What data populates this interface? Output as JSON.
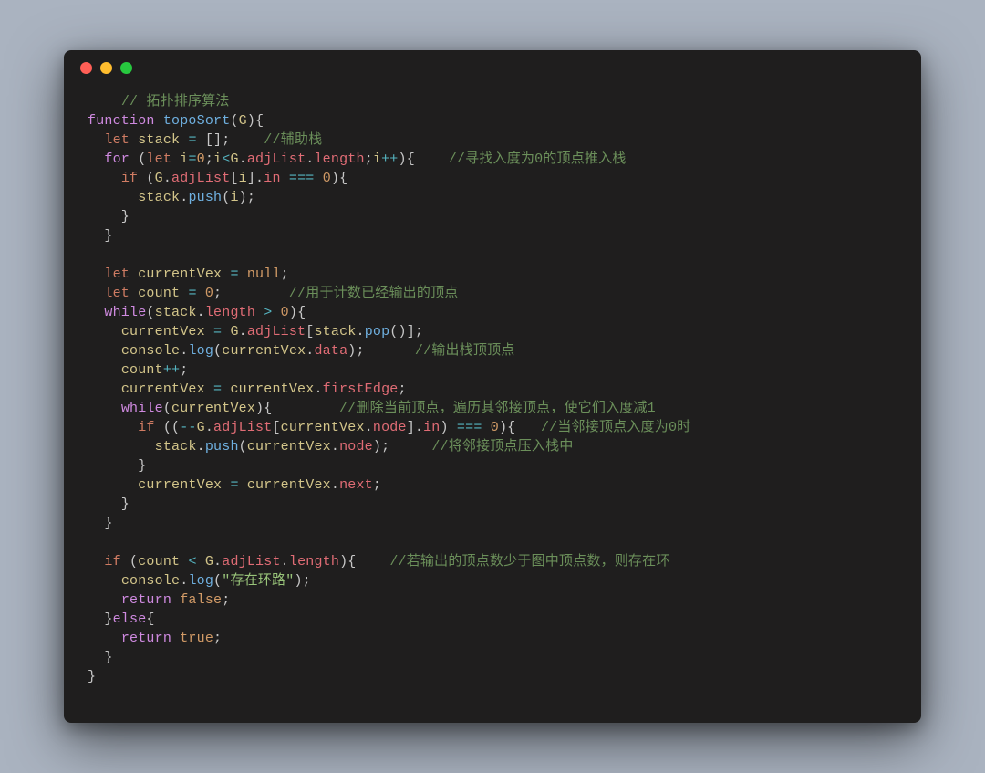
{
  "language": "javascript",
  "theme": "dark-mac-window",
  "window": {
    "traffic_lights": [
      "close",
      "minimize",
      "zoom"
    ]
  },
  "code_tokens": [
    [
      [
        "pl",
        "    "
      ],
      [
        "cmt",
        "// 拓扑排序算法"
      ]
    ],
    [
      [
        "kw",
        "function"
      ],
      [
        "pl",
        " "
      ],
      [
        "fn",
        "topoSort"
      ],
      [
        "pl",
        "("
      ],
      [
        "id",
        "G"
      ],
      [
        "pl",
        "){"
      ]
    ],
    [
      [
        "pl",
        "  "
      ],
      [
        "kw2",
        "let"
      ],
      [
        "pl",
        " "
      ],
      [
        "id",
        "stack"
      ],
      [
        "pl",
        " "
      ],
      [
        "op",
        "="
      ],
      [
        "pl",
        " [];    "
      ],
      [
        "cmt",
        "//辅助栈"
      ]
    ],
    [
      [
        "pl",
        "  "
      ],
      [
        "kw",
        "for"
      ],
      [
        "pl",
        " ("
      ],
      [
        "kw2",
        "let"
      ],
      [
        "pl",
        " "
      ],
      [
        "id",
        "i"
      ],
      [
        "op",
        "="
      ],
      [
        "num",
        "0"
      ],
      [
        "pl",
        ";"
      ],
      [
        "id",
        "i"
      ],
      [
        "op",
        "<"
      ],
      [
        "id",
        "G"
      ],
      [
        "pl",
        "."
      ],
      [
        "prop",
        "adjList"
      ],
      [
        "pl",
        "."
      ],
      [
        "prop",
        "length"
      ],
      [
        "pl",
        ";"
      ],
      [
        "id",
        "i"
      ],
      [
        "op",
        "++"
      ],
      [
        "pl",
        "){    "
      ],
      [
        "cmt",
        "//寻找入度为0的顶点推入栈"
      ]
    ],
    [
      [
        "pl",
        "    "
      ],
      [
        "kw2",
        "if"
      ],
      [
        "pl",
        " ("
      ],
      [
        "id",
        "G"
      ],
      [
        "pl",
        "."
      ],
      [
        "prop",
        "adjList"
      ],
      [
        "pl",
        "["
      ],
      [
        "id",
        "i"
      ],
      [
        "pl",
        "]."
      ],
      [
        "prop",
        "in"
      ],
      [
        "pl",
        " "
      ],
      [
        "op",
        "==="
      ],
      [
        "pl",
        " "
      ],
      [
        "num",
        "0"
      ],
      [
        "pl",
        "){"
      ]
    ],
    [
      [
        "pl",
        "      "
      ],
      [
        "id",
        "stack"
      ],
      [
        "pl",
        "."
      ],
      [
        "fn",
        "push"
      ],
      [
        "pl",
        "("
      ],
      [
        "id",
        "i"
      ],
      [
        "pl",
        ");"
      ]
    ],
    [
      [
        "pl",
        "    }"
      ]
    ],
    [
      [
        "pl",
        "  }"
      ]
    ],
    [
      [
        "pl",
        ""
      ]
    ],
    [
      [
        "pl",
        "  "
      ],
      [
        "kw2",
        "let"
      ],
      [
        "pl",
        " "
      ],
      [
        "id",
        "currentVex"
      ],
      [
        "pl",
        " "
      ],
      [
        "op",
        "="
      ],
      [
        "pl",
        " "
      ],
      [
        "num",
        "null"
      ],
      [
        "pl",
        ";"
      ]
    ],
    [
      [
        "pl",
        "  "
      ],
      [
        "kw2",
        "let"
      ],
      [
        "pl",
        " "
      ],
      [
        "id",
        "count"
      ],
      [
        "pl",
        " "
      ],
      [
        "op",
        "="
      ],
      [
        "pl",
        " "
      ],
      [
        "num",
        "0"
      ],
      [
        "pl",
        ";        "
      ],
      [
        "cmt",
        "//用于计数已经输出的顶点"
      ]
    ],
    [
      [
        "pl",
        "  "
      ],
      [
        "kw",
        "while"
      ],
      [
        "pl",
        "("
      ],
      [
        "id",
        "stack"
      ],
      [
        "pl",
        "."
      ],
      [
        "prop",
        "length"
      ],
      [
        "pl",
        " "
      ],
      [
        "op",
        ">"
      ],
      [
        "pl",
        " "
      ],
      [
        "num",
        "0"
      ],
      [
        "pl",
        "){"
      ]
    ],
    [
      [
        "pl",
        "    "
      ],
      [
        "id",
        "currentVex"
      ],
      [
        "pl",
        " "
      ],
      [
        "op",
        "="
      ],
      [
        "pl",
        " "
      ],
      [
        "id",
        "G"
      ],
      [
        "pl",
        "."
      ],
      [
        "prop",
        "adjList"
      ],
      [
        "pl",
        "["
      ],
      [
        "id",
        "stack"
      ],
      [
        "pl",
        "."
      ],
      [
        "fn",
        "pop"
      ],
      [
        "pl",
        "()];"
      ]
    ],
    [
      [
        "pl",
        "    "
      ],
      [
        "id",
        "console"
      ],
      [
        "pl",
        "."
      ],
      [
        "fn",
        "log"
      ],
      [
        "pl",
        "("
      ],
      [
        "id",
        "currentVex"
      ],
      [
        "pl",
        "."
      ],
      [
        "prop",
        "data"
      ],
      [
        "pl",
        ");      "
      ],
      [
        "cmt",
        "//输出栈顶顶点"
      ]
    ],
    [
      [
        "pl",
        "    "
      ],
      [
        "id",
        "count"
      ],
      [
        "op",
        "++"
      ],
      [
        "pl",
        ";"
      ]
    ],
    [
      [
        "pl",
        "    "
      ],
      [
        "id",
        "currentVex"
      ],
      [
        "pl",
        " "
      ],
      [
        "op",
        "="
      ],
      [
        "pl",
        " "
      ],
      [
        "id",
        "currentVex"
      ],
      [
        "pl",
        "."
      ],
      [
        "prop",
        "firstEdge"
      ],
      [
        "pl",
        ";"
      ]
    ],
    [
      [
        "pl",
        "    "
      ],
      [
        "kw",
        "while"
      ],
      [
        "pl",
        "("
      ],
      [
        "id",
        "currentVex"
      ],
      [
        "pl",
        "){        "
      ],
      [
        "cmt",
        "//删除当前顶点，遍历其邻接顶点，使它们入度减1"
      ]
    ],
    [
      [
        "pl",
        "      "
      ],
      [
        "kw2",
        "if"
      ],
      [
        "pl",
        " (("
      ],
      [
        "op",
        "--"
      ],
      [
        "id",
        "G"
      ],
      [
        "pl",
        "."
      ],
      [
        "prop",
        "adjList"
      ],
      [
        "pl",
        "["
      ],
      [
        "id",
        "currentVex"
      ],
      [
        "pl",
        "."
      ],
      [
        "prop",
        "node"
      ],
      [
        "pl",
        "]."
      ],
      [
        "prop",
        "in"
      ],
      [
        "pl",
        ") "
      ],
      [
        "op",
        "==="
      ],
      [
        "pl",
        " "
      ],
      [
        "num",
        "0"
      ],
      [
        "pl",
        "){   "
      ],
      [
        "cmt",
        "//当邻接顶点入度为0时"
      ]
    ],
    [
      [
        "pl",
        "        "
      ],
      [
        "id",
        "stack"
      ],
      [
        "pl",
        "."
      ],
      [
        "fn",
        "push"
      ],
      [
        "pl",
        "("
      ],
      [
        "id",
        "currentVex"
      ],
      [
        "pl",
        "."
      ],
      [
        "prop",
        "node"
      ],
      [
        "pl",
        ");     "
      ],
      [
        "cmt",
        "//将邻接顶点压入栈中"
      ]
    ],
    [
      [
        "pl",
        "      }"
      ]
    ],
    [
      [
        "pl",
        "      "
      ],
      [
        "id",
        "currentVex"
      ],
      [
        "pl",
        " "
      ],
      [
        "op",
        "="
      ],
      [
        "pl",
        " "
      ],
      [
        "id",
        "currentVex"
      ],
      [
        "pl",
        "."
      ],
      [
        "prop",
        "next"
      ],
      [
        "pl",
        ";"
      ]
    ],
    [
      [
        "pl",
        "    }"
      ]
    ],
    [
      [
        "pl",
        "  }"
      ]
    ],
    [
      [
        "pl",
        ""
      ]
    ],
    [
      [
        "pl",
        "  "
      ],
      [
        "kw2",
        "if"
      ],
      [
        "pl",
        " ("
      ],
      [
        "id",
        "count"
      ],
      [
        "pl",
        " "
      ],
      [
        "op",
        "<"
      ],
      [
        "pl",
        " "
      ],
      [
        "id",
        "G"
      ],
      [
        "pl",
        "."
      ],
      [
        "prop",
        "adjList"
      ],
      [
        "pl",
        "."
      ],
      [
        "prop",
        "length"
      ],
      [
        "pl",
        "){    "
      ],
      [
        "cmt",
        "//若输出的顶点数少于图中顶点数，则存在环"
      ]
    ],
    [
      [
        "pl",
        "    "
      ],
      [
        "id",
        "console"
      ],
      [
        "pl",
        "."
      ],
      [
        "fn",
        "log"
      ],
      [
        "pl",
        "("
      ],
      [
        "str",
        "\"存在环路\""
      ],
      [
        "pl",
        ");"
      ]
    ],
    [
      [
        "pl",
        "    "
      ],
      [
        "kw",
        "return"
      ],
      [
        "pl",
        " "
      ],
      [
        "num",
        "false"
      ],
      [
        "pl",
        ";"
      ]
    ],
    [
      [
        "pl",
        "  }"
      ],
      [
        "kw",
        "else"
      ],
      [
        "pl",
        "{"
      ]
    ],
    [
      [
        "pl",
        "    "
      ],
      [
        "kw",
        "return"
      ],
      [
        "pl",
        " "
      ],
      [
        "num",
        "true"
      ],
      [
        "pl",
        ";"
      ]
    ],
    [
      [
        "pl",
        "  }"
      ]
    ],
    [
      [
        "pl",
        "}"
      ]
    ]
  ]
}
